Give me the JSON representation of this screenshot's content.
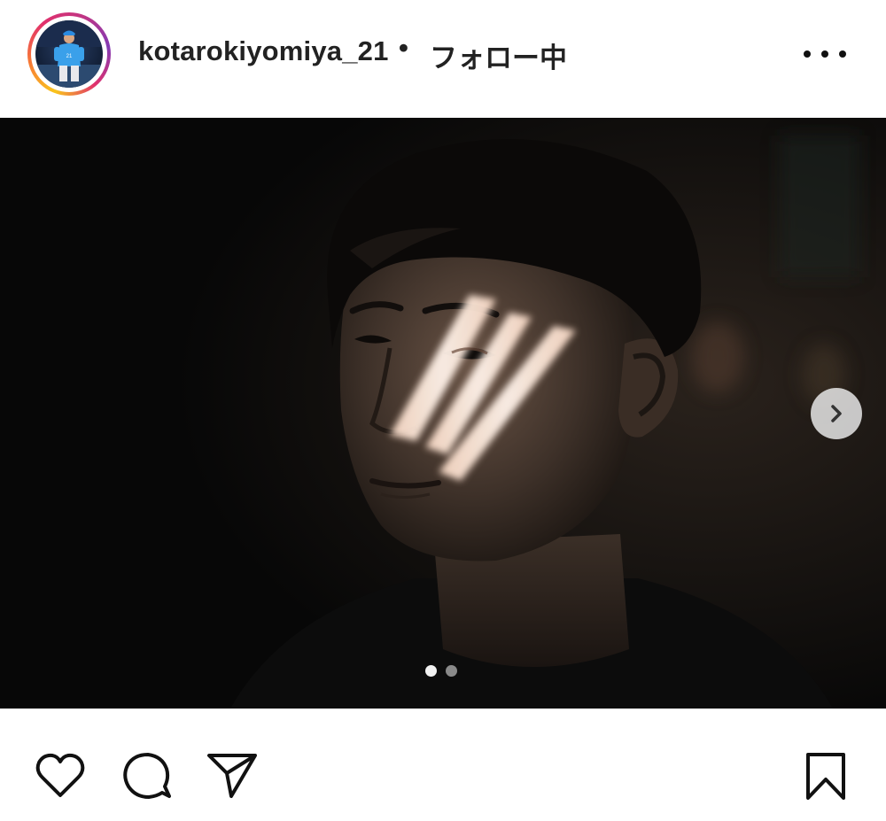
{
  "header": {
    "username": "kotarokiyomiya_21",
    "separator": "•",
    "follow_status": "フォロー中"
  },
  "icons": {
    "avatar": "profile-photo-baseball-player",
    "more": "more-options-icon",
    "next": "chevron-right-icon",
    "like": "heart-icon",
    "comment": "comment-bubble-icon",
    "share": "paper-plane-icon",
    "save": "bookmark-icon"
  },
  "carousel": {
    "total_slides": 2,
    "current_slide": 1
  },
  "colors": {
    "story_ring": [
      "#f9c51c",
      "#f77737",
      "#e1306c",
      "#c13584",
      "#833ab4"
    ],
    "text": "#222222",
    "photo_background": "#080808"
  }
}
